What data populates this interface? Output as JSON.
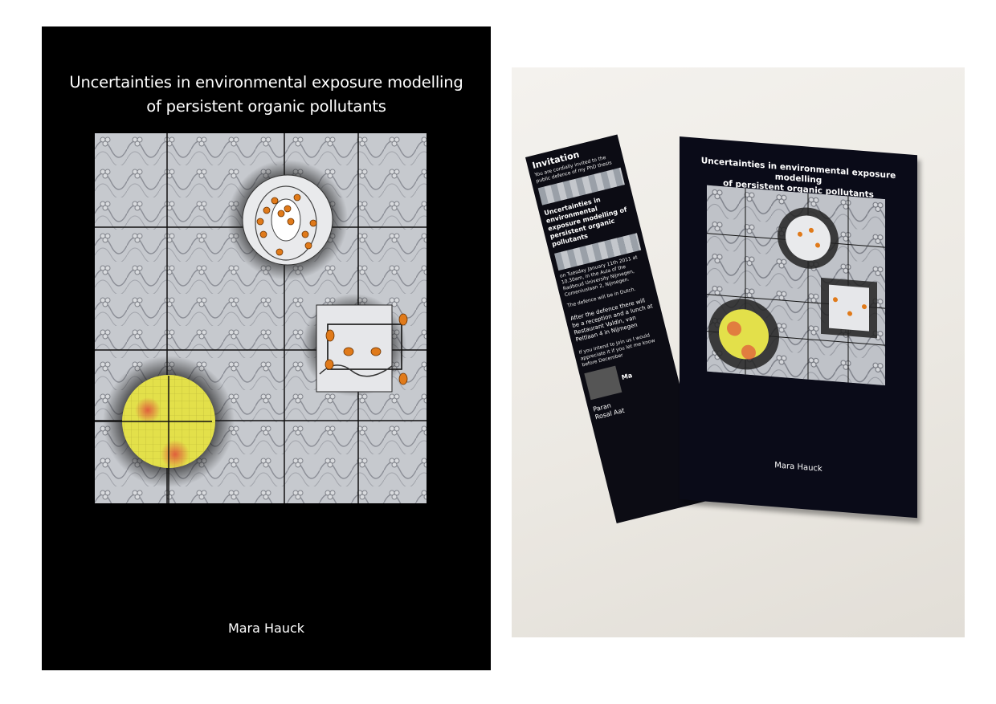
{
  "cover": {
    "title_line1": "Uncertainties in environmental exposure modelling",
    "title_line2": "of persistent organic pollutants",
    "author": "Mara Hauck"
  },
  "book": {
    "title_line1": "Uncertainties in environmental exposure modelling",
    "title_line2": "of persistent organic pollutants",
    "author": "Mara Hauck"
  },
  "bookmark": {
    "heading": "Invitation",
    "intro": "You are cordially invited to the public defence of my PhD thesis",
    "thesis_title": "Uncertainties in environmental exposure modelling of persistent organic pollutants",
    "details": "on Tuesday January 11th 2011 at 10.30am, in the Aula of the Radboud University Nijmegen, Comeniuslaan 2, Nijmegen.",
    "language": "The defence will be in Dutch.",
    "reception": "After the defence there will be a reception and a lunch at Restaurant Valdin, van Peltlaan 4 in Nijmegen",
    "rsvp": "If you intend to join us I would appreciate it if you let me know before December",
    "sign": "Ma",
    "paranymphs": "Paran Rosal Aat"
  },
  "colors": {
    "cover_bg": "#000000",
    "accent_orange": "#e07a1a",
    "accent_yellow": "#e3e04a",
    "accent_red": "#e0523a"
  }
}
